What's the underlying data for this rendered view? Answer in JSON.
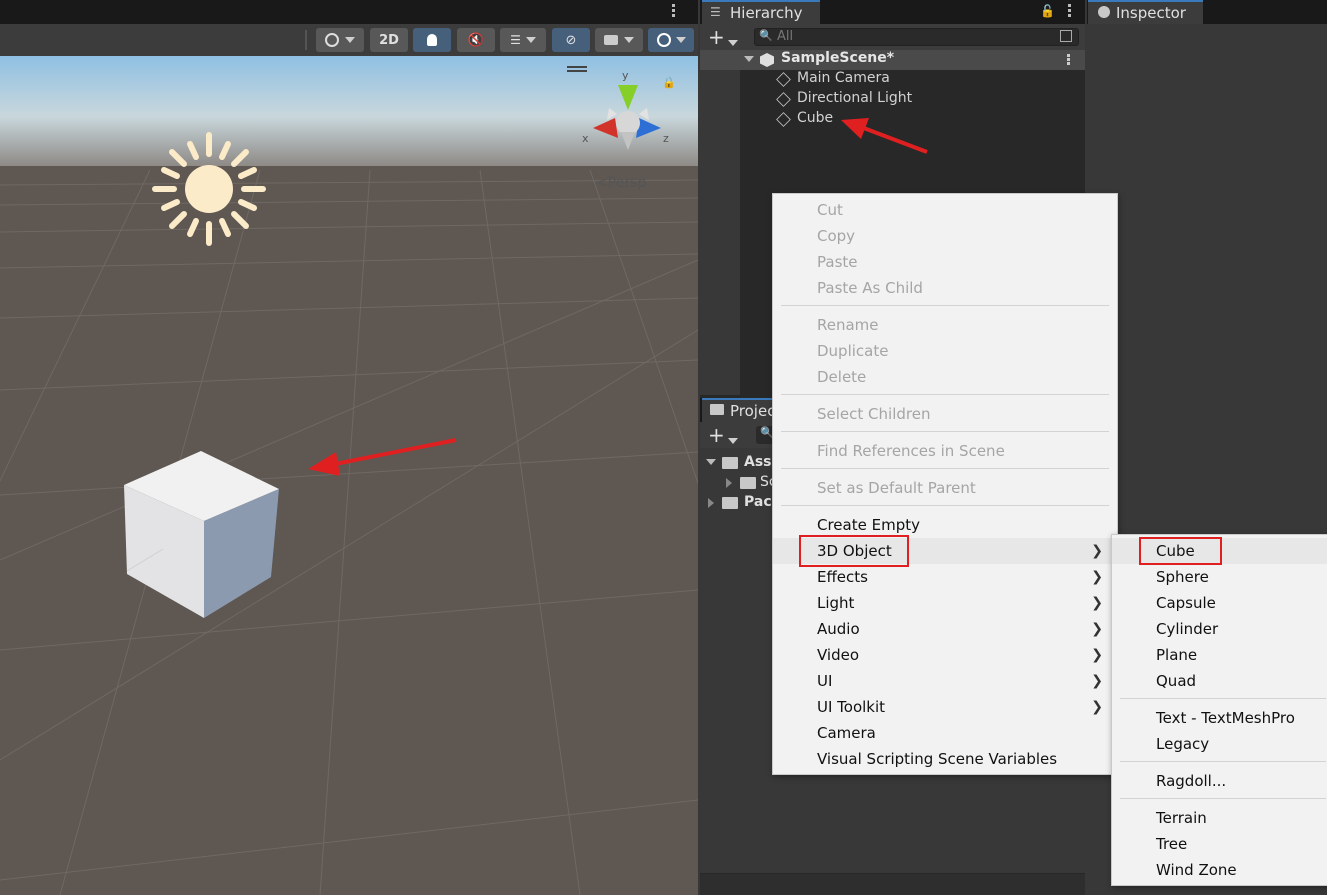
{
  "scene_view": {
    "camera_label": "Persp",
    "toolbar": {
      "mode_2d": "2D"
    },
    "gizmo": {
      "y": "y",
      "x": "x",
      "z": "z"
    }
  },
  "hierarchy": {
    "tab_label": "Hierarchy",
    "search_placeholder": "All",
    "scene_name": "SampleScene*",
    "items": [
      "Main Camera",
      "Directional Light",
      "Cube"
    ]
  },
  "project": {
    "tab_label": "Projec",
    "tree": [
      "Ass",
      "Sc",
      "Pac"
    ]
  },
  "inspector": {
    "tab_label": "Inspector"
  },
  "context_menu": {
    "items": [
      {
        "label": "Cut",
        "disabled": true
      },
      {
        "label": "Copy",
        "disabled": true
      },
      {
        "label": "Paste",
        "disabled": true
      },
      {
        "label": "Paste As Child",
        "disabled": true
      },
      {
        "label": "Rename",
        "disabled": true
      },
      {
        "label": "Duplicate",
        "disabled": true
      },
      {
        "label": "Delete",
        "disabled": true
      },
      {
        "label": "Select Children",
        "disabled": true
      },
      {
        "label": "Find References in Scene",
        "disabled": true
      },
      {
        "label": "Set as Default Parent",
        "disabled": true
      },
      {
        "label": "Create Empty",
        "disabled": false
      },
      {
        "label": "3D Object",
        "disabled": false,
        "submenu": true
      },
      {
        "label": "Effects",
        "disabled": false,
        "submenu": true
      },
      {
        "label": "Light",
        "disabled": false,
        "submenu": true
      },
      {
        "label": "Audio",
        "disabled": false,
        "submenu": true
      },
      {
        "label": "Video",
        "disabled": false,
        "submenu": true
      },
      {
        "label": "UI",
        "disabled": false,
        "submenu": true
      },
      {
        "label": "UI Toolkit",
        "disabled": false,
        "submenu": true
      },
      {
        "label": "Camera",
        "disabled": false
      },
      {
        "label": "Visual Scripting Scene Variables",
        "disabled": false
      }
    ]
  },
  "submenu_3d_object": {
    "items": [
      "Cube",
      "Sphere",
      "Capsule",
      "Cylinder",
      "Plane",
      "Quad",
      "Text - TextMeshPro",
      "Legacy",
      "Ragdoll...",
      "Terrain",
      "Tree",
      "Wind Zone"
    ]
  },
  "colors": {
    "annotation_red": "#e02020",
    "selection_blue": "#3a79bb",
    "menu_bg": "#f2f2f2"
  }
}
